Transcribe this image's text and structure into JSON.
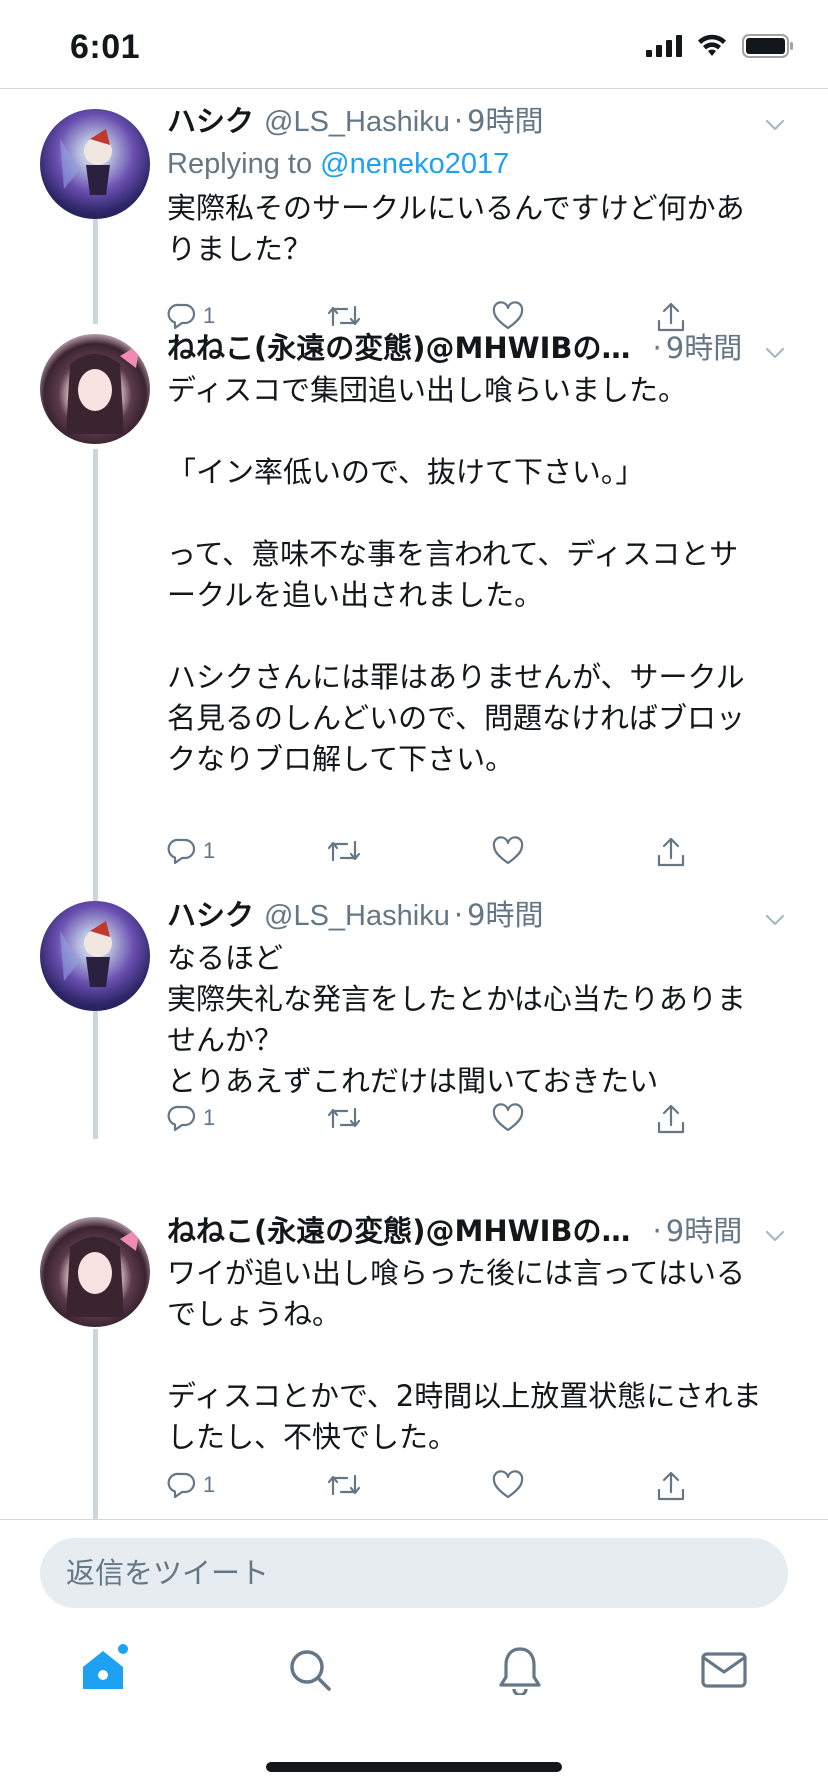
{
  "status_bar": {
    "time": "6:01"
  },
  "tweets": [
    {
      "name": "ハシク",
      "handle": "@LS_Hashiku",
      "time": "9時間",
      "reply_prefix": "Replying to ",
      "reply_mention": "@neneko2017",
      "text": "実際私そのサークルにいるんですけど何かあ\nりました？",
      "reply_count": "1"
    },
    {
      "name": "ねねこ(永遠の変態)@MHWIBの…",
      "handle": "",
      "time": "9時間",
      "text": "ディスコで集団追い出し喰らいました。\n\n「イン率低いので、抜けて下さい。」\n\nって、意味不な事を言われて、ディスコとサ\nークルを追い出されました。\n\nハシクさんには罪はありませんが、サークル\n名見るのしんどいので、問題なければブロッ\nクなりブロ解して下さい。",
      "reply_count": "1"
    },
    {
      "name": "ハシク",
      "handle": "@LS_Hashiku",
      "time": "9時間",
      "text": "なるほど\n実際失礼な発言をしたとかは心当たりありま\nせんか？\nとりあえずこれだけは聞いておきたい",
      "reply_count": "1"
    },
    {
      "name": "ねねこ(永遠の変態)@MHWIBの…",
      "handle": "",
      "time": "9時間",
      "text": "ワイが追い出し喰らった後には言ってはいる\nでしょうね。\n\nディスコとかで、2時間以上放置状態にされま\nしたし、不快でした。",
      "reply_count": "1"
    }
  ],
  "separator": "·",
  "compose": {
    "placeholder": "返信をツイート"
  },
  "tabs": [
    "home-icon",
    "search-icon",
    "notifications-icon",
    "messages-icon"
  ],
  "colors": {
    "accent": "#1da1f2",
    "text": "#14171a",
    "secondary": "#657786",
    "divider": "#ccd6dd",
    "compose_bg": "#e6ecf0"
  }
}
